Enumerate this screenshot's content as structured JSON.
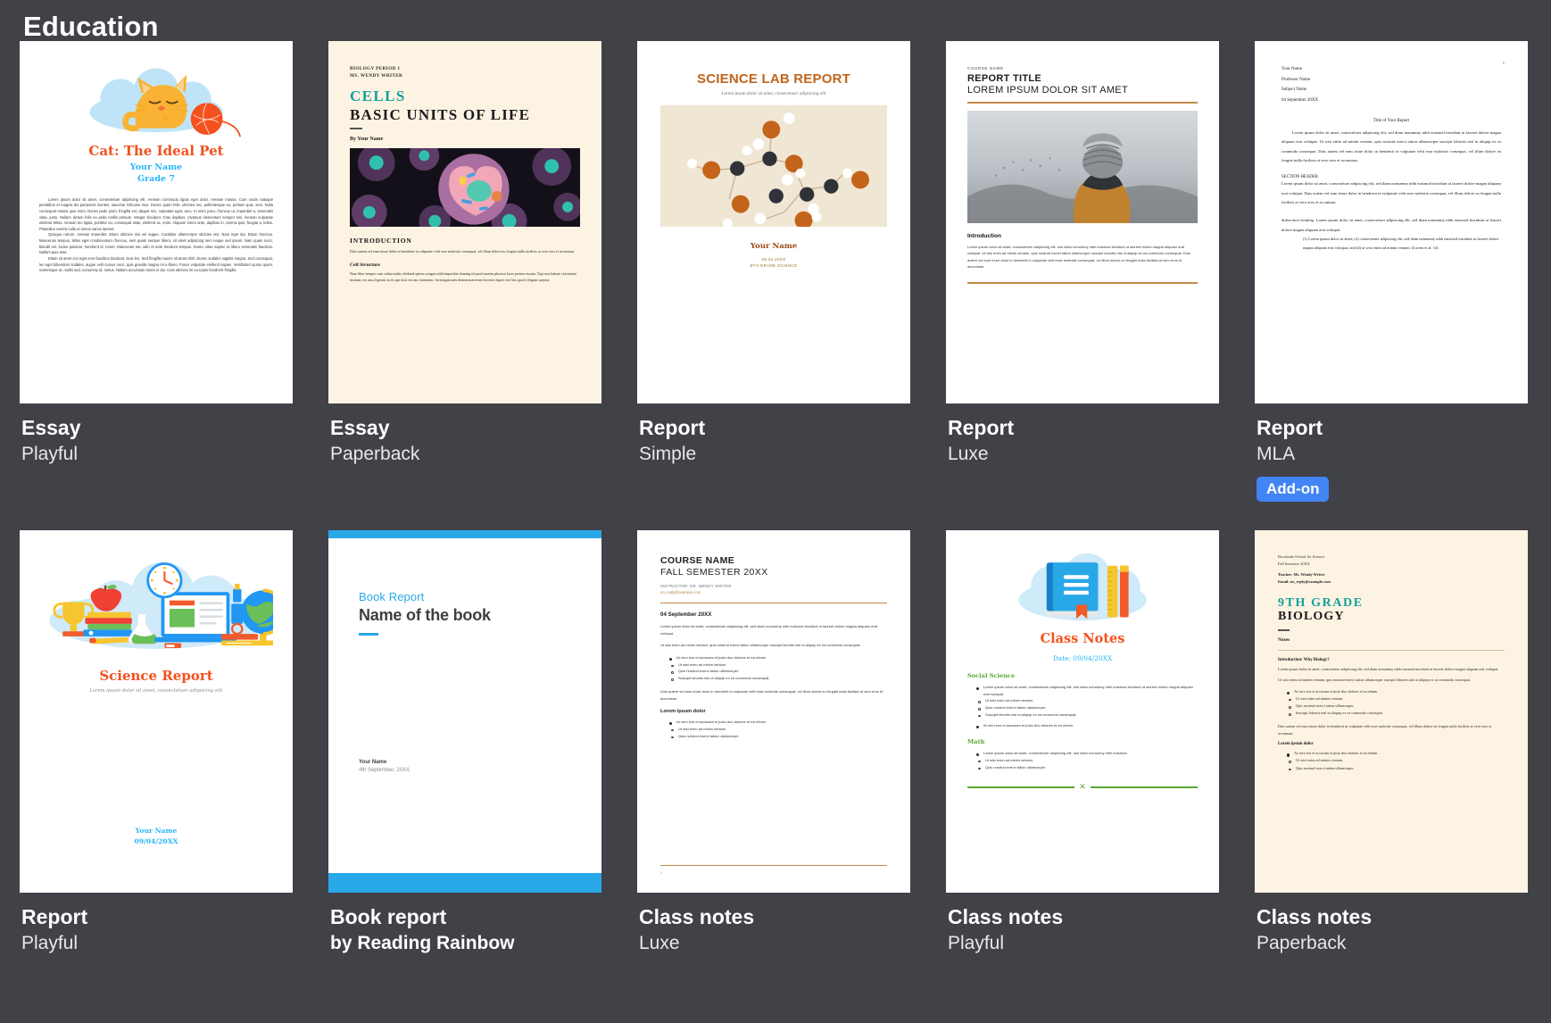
{
  "header": {
    "title": "Education"
  },
  "templates": [
    {
      "name": "Essay",
      "style": "Playful",
      "badge": null,
      "doc": {
        "title": "Cat: The Ideal Pet",
        "author": "Your Name",
        "grade": "Grade 7",
        "p1": "Lorem ipsum dolor sit amet, consectetuer adipiscing elit. Aenean commodo ligula eget dolor. Aenean massa. Cum sociis natoque penatibus et magnis dis parturient montes, nascetur ridiculus mus. Donec quam felis, ultricies nec, pellentesque eu, pretium quis, sem. Nulla consequat massa quis enim. Donec pede justo, fringilla vel, aliquet nec, vulputate eget, arcu. In enim justo, rhoncus ut, imperdiet a, venenatis vitae, justo. Nullam dictum felis eu pede mollis pretium. Integer tincidunt. Cras dapibus. Vivamus elementum semper nisi. Aenean vulputate eleifend tellus. Aenean leo ligula, porttitor eu, consequat vitae, eleifend ac, enim. Aliquam lorem ante, dapibus in, viverra quis, feugiat a, tellus. Phasellus viverra nulla ut metus varius laoreet.",
        "p2": "Quisque rutrum. Aenean imperdiet. Etiam ultricies nisi vel augue. Curabitur ullamcorper ultricies nisi. Nam eget dui. Etiam rhoncus. Maecenas tempus, tellus eget condimentum rhoncus, sem quam semper libero, sit amet adipiscing sem neque sed ipsum. Nam quam nunc, blandit vel, luctus pulvinar, hendrerit id, lorem. Maecenas nec odio et ante tincidunt tempus. Donec vitae sapien ut libero venenatis faucibus. Nullam quis ante.",
        "p3": "Etiam sit amet orci eget eros faucibus tincidunt. Duis leo. Sed fringilla mauris sit amet nibh. Donec sodales sagittis magna. Sed consequat, leo eget bibendum sodales, augue velit cursus nunc, quis gravida magna mi a libero. Fusce vulputate eleifend sapien. Vestibulum purus quam, scelerisque ut, mollis sed, nonummy id, metus. Nullam accumsan lorem in dui. Cras ultricies mi eu turpis hendrerit fringilla."
      }
    },
    {
      "name": "Essay",
      "style": "Paperback",
      "badge": null,
      "doc": {
        "kicker1": "BIOLOGY PERIOD 1",
        "kicker2": "MS. WENDY WRITER",
        "title_teal": "CELLS",
        "title_dark": "BASIC UNITS OF LIFE",
        "byline": "By Your Name",
        "h_intro": "INTRODUCTION",
        "intro_body": "Duis autem vel eum iriure dolor in hendrerit in vulputate velit esse molestie consequat, vel illum dolore eu feugiat nulla facilisis at vero eros et accumsan.",
        "h_struct": "Cell Structure",
        "struct_body": "Nam liber tempor cum soluta nobis eleifend option congue nihil imperdiet doming id quod mazim placerat facer possim assum. Typi non habent claritatem insitam; est usus legentis in iis qui facit eorum claritatem. Investigationes demonstraverunt lectores legere me lius quod ii legunt saepius."
      }
    },
    {
      "name": "Report",
      "style": "Simple",
      "badge": null,
      "doc": {
        "title": "SCIENCE LAB REPORT",
        "tagline": "Lorem ipsum dolor sit amet, consectetuer adipiscing elit",
        "author": "Your Name",
        "date": "09.04.20XX",
        "course": "8TH GRADE SCIENCE"
      }
    },
    {
      "name": "Report",
      "style": "Luxe",
      "badge": null,
      "doc": {
        "course": "COURSE NAME",
        "title1": "REPORT TITLE",
        "title2": "LOREM IPSUM DOLOR SIT AMET",
        "h_intro": "Introduction",
        "intro_body": "Lorem ipsum dolor sit amet, consectetuer adipiscing elit, sed diam nonummy nibh euismod tincidunt ut laoreet dolore magna aliquam erat volutpat. Ut wisi enim ad minim veniam, quis nostrud exerci tation ullamcorper suscipit lobortis nisl ut aliquip ex ea commodo consequat. Duis autem vel eum iriure dolor in hendrerit in vulputate velit esse molestie consequat, vel illum dolore eu feugiat nulla facilisis at vero eros et accumsan."
      }
    },
    {
      "name": "Report",
      "style": "MLA",
      "badge": "Add-on",
      "doc": {
        "page_number": "1",
        "line1": "Your Name",
        "line2": "Professor Name",
        "line3": "Subject Name",
        "line4": "04 September 20XX",
        "title": "Title of Your Report",
        "body1": "Lorem ipsum dolor sit amet, consectetuer adipiscing elit, sed diam nonummy nibh euismod tincidunt ut laoreet dolore magna aliquam erat volutpat. Ut wisi enim ad minim veniam, quis nostrud exerci tation ullamcorper suscipit lobortis nisl ut aliquip ex ea commodo consequat. Duis autem vel eum iriure dolor in hendrerit in vulputate velit esse molestie consequat, vel illum dolore eu feugiat nulla facilisis at vero eros et accumsan.",
        "section_header": "SECTION HEADER",
        "body2": "Lorem ipsum dolor sit amet, consectetuer adipiscing elit, sed diam nonummy nibh euismod tincidunt ut laoreet dolore magna aliquam erat volutpat. Duis autem vel eum iriure dolor in hendrerit in vulputate velit esse molestie consequat, vel illum dolore eu feugiat nulla facilisis at vero eros et accumsan.",
        "subsection_label": "Subsection heading.",
        "body3": "Lorem ipsum dolor sit amet, consectetuer adipiscing elit, sed diam nonummy nibh euismod tincidunt ut laoreet dolore magna aliquam erat volutpat.",
        "quote": "(1) Lorem ipsum dolor sit amet; (2) consectetuer adipiscing elit, sed diam nonummy nibh euismod tincidunt ut laoreet dolore magna aliquam erat volutpat; and (4) ut wisi enim ad minim veniam. (Lorem et al. 14)"
      }
    },
    {
      "name": "Report",
      "style": "Playful",
      "badge": null,
      "doc": {
        "title": "Science Report",
        "tagline": "Lorem ipsum dolor sit amet, consectetuer adipiscing elit",
        "author": "Your Name",
        "date": "09/04/20XX"
      }
    },
    {
      "name": "Book report",
      "style": "by Reading Rainbow",
      "style_strong": true,
      "badge": null,
      "doc": {
        "kicker": "Book Report",
        "title": "Name of the book",
        "author": "Your Name",
        "date": "4th September, 20XX"
      }
    },
    {
      "name": "Class notes",
      "style": "Luxe",
      "badge": null,
      "doc": {
        "course": "COURSE NAME",
        "semester": "FALL SEMESTER 20XX",
        "instructor": "INSTRUCTOR: DR. WENDY WRITER",
        "email": "no_reply@example.com",
        "date": "04 September 20XX",
        "body1": "Lorem ipsum dolor sit amet, consectetuer adipiscing elit, sed diam nonummy nibh euismod tincidunt ut laoreet dolore magna aliquam erat volutpat.",
        "body2": "Ut wisi enim ad minim veniam, quis nostrud exerci tation ullamcorper suscipit lobortis nisl ut aliquip ex ea commodo consequat.",
        "bullet1": "At vero eos et accusam et justo duo dolores et ea rebum",
        "subs": [
          "Ut wisi enim ad minim veniam.",
          "Quis nostrud exerci tation ullamcorper.",
          "Suscipit lobortis nisl ut aliquip ex ea commodo consequat."
        ],
        "body3": "Duis autem vel eum iriure dolor in hendrerit in vulputate velit esse molestie consequat, vel illum dolore eu feugiat nulla facilisis at vero eros et accumsan.",
        "h2": "Lorem ipsum dolor",
        "bullet2": "At vero eos et accusam et justo duo dolores et ea rebum",
        "subs2": [
          "Ut wisi enim ad minim veniam.",
          "Quis nostrud exerci tation ullamcorper."
        ],
        "page_number": "1"
      }
    },
    {
      "name": "Class notes",
      "style": "Playful",
      "badge": null,
      "doc": {
        "title": "Class Notes",
        "date": "Date: 09/04/20XX",
        "sec1": "Social Science",
        "sec1_b1": "Lorem ipsum dolor sit amet, consectetuer adipiscing elit, sed diam nonummy nibh euismod tincidunt ut laoreet dolore magna aliquam erat volutpat.",
        "sec1_subs": [
          "Ut wisi enim ad minim veniam.",
          "Quis nostrud exerci tation ullamcorper.",
          "Suscipit lobortis nisl ut aliquip ex ea commodo consequat."
        ],
        "sec1_b2": "At vero eos et accusam et justo duo dolores et ea rebum.",
        "sec2": "Math",
        "sec2_b1": "Lorem ipsum dolor sit amet, consectetuer adipiscing elit, sed diam nonummy nibh euismod.",
        "sec2_subs": [
          "Ut wisi enim ad minim veniam.",
          "Quis nostrud exerci tation ullamcorper."
        ]
      }
    },
    {
      "name": "Class notes",
      "style": "Paperback",
      "badge": null,
      "doc": {
        "school": "Brookside School for Science",
        "semester": "Fall Semester 20XX",
        "teacher": "Teacher: Ms. Wendy Writer",
        "email": "Email: no_reply@example.com",
        "title_teal": "9TH GRADE",
        "title_dark": "BIOLOGY",
        "notes_label": "Notes",
        "h_intro": "Introduction: Why Biology?",
        "body1": "Lorem ipsum dolor sit amet, consectetuer adipiscing elit, sed diam nonummy nibh euismod tincidunt ut laoreet dolore magna aliquam erat volutpat.",
        "body2": "Ut wisi enim ad minim veniam, quis nostrud exerci tation ullamcorper suscipit lobortis nisl ut aliquip ex ea commodo consequat.",
        "bullet1": "At vero eos et accusam et justo duo dolores et ea rebum",
        "subs": [
          "Ut wisi enim ad minim veniam.",
          "Quis nostrud exerci tation ullamcorper.",
          "Suscipit lobortis nisl ut aliquip ex ea commodo consequat."
        ],
        "body3": "Duis autem vel eum iriure dolor in hendrerit in vulputate velit esse molestie consequat, vel illum dolore eu feugiat nulla facilisis at vero eros et accumsan.",
        "h2": "Lorem ipsum dolor",
        "bullet2": "At vero eos et accusam et justo duo dolores et ea rebum",
        "subs2": [
          "Ut wisi enim ad minim veniam.",
          "Quis nostrud exerci tation ullamcorper."
        ]
      }
    }
  ],
  "colors": {
    "background": "#414148",
    "badge": "#4285f4",
    "playful_orange": "#f4511e",
    "playful_blue": "#29b6f6",
    "paperback_cream": "#fdf3e3",
    "paperback_teal": "#12a19a",
    "simple_orange": "#c0651a",
    "luxe_rule": "#c4894a",
    "rainbow_blue": "#29a8e8",
    "playful_green": "#5aa832"
  }
}
